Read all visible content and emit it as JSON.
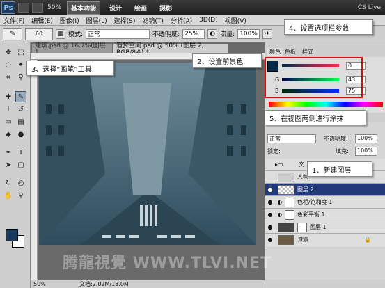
{
  "appbar": {
    "logo": "Ps",
    "zoom": "50%",
    "workspaces": [
      "基本功能",
      "设计",
      "绘画",
      "摄影"
    ],
    "active_workspace": "基本功能",
    "cs_live": "CS Live"
  },
  "menu": [
    "文件(F)",
    "编辑(E)",
    "图像(I)",
    "图层(L)",
    "选择(S)",
    "滤镜(T)",
    "分析(A)",
    "3D(D)",
    "视图(V)"
  ],
  "options": {
    "brush_size": "60",
    "mode_label": "模式:",
    "mode_value": "正常",
    "opacity_label": "不透明度:",
    "opacity_value": "25%",
    "flow_label": "流量:",
    "flow_value": "100%"
  },
  "documents": {
    "tab1": "建筑.psd @ 16.7%(图层 1...",
    "tab2": "造梦空间.psd @ 50% (图层 2, RGB/8#) *"
  },
  "status": {
    "zoom": "50%",
    "doc": "文档:2.02M/13.0M"
  },
  "color_panel": {
    "tabs": [
      "颜色",
      "色板",
      "样式"
    ],
    "r_label": "R",
    "r_value": "0",
    "g_label": "G",
    "g_value": "43",
    "b_label": "B",
    "b_value": "75",
    "fg_color": "#002b4b"
  },
  "layers_panel": {
    "mode": "正常",
    "opacity_label": "不透明度:",
    "opacity_value": "100%",
    "lock_label": "锁定:",
    "fill_label": "填充:",
    "fill_value": "100%",
    "layers": [
      {
        "name": "文",
        "kind": "group"
      },
      {
        "name": "人物",
        "kind": "normal"
      },
      {
        "name": "图层 2",
        "kind": "normal",
        "selected": true
      },
      {
        "name": "色相/饱和度 1",
        "kind": "adjustment"
      },
      {
        "name": "色彩平衡 1",
        "kind": "adjustment"
      },
      {
        "name": "图层 1",
        "kind": "normal"
      },
      {
        "name": "背景",
        "kind": "background"
      }
    ]
  },
  "callouts": {
    "c1": "1、新建图层",
    "c2": "2、设置前景色",
    "c3": "3、选择“画笔”工具",
    "c4": "4、设置选项栏参数",
    "c5": "5、在视图两侧进行涂抹"
  },
  "watermark": "腾龍視覺 WWW.TLVI.NET",
  "colors": {
    "highlight": "#d01010",
    "selected_layer": "#233a7a"
  }
}
